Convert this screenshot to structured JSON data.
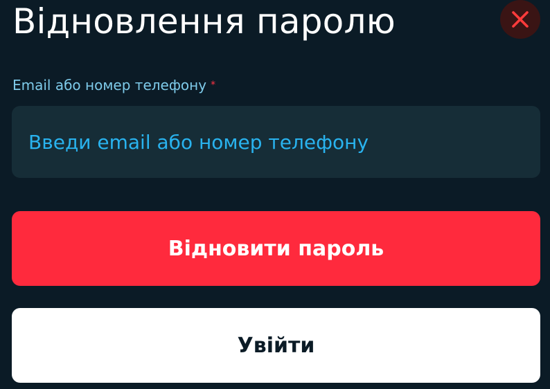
{
  "title": "Відновлення паролю",
  "close_icon": "close-icon",
  "form": {
    "label": "Email або номер телефону",
    "required_mark": "*",
    "input_value": "",
    "input_placeholder": "Введи email або номер телефону"
  },
  "buttons": {
    "restore_label": "Відновити пароль",
    "login_label": "Увійти"
  },
  "colors": {
    "background": "#0b1b26",
    "accent_red": "#ff2a3d",
    "label_blue": "#7ecbea",
    "placeholder_blue": "#29b3ef",
    "input_bg": "#162d37",
    "close_bg": "#3a1414",
    "close_x": "#ff3b3b"
  }
}
